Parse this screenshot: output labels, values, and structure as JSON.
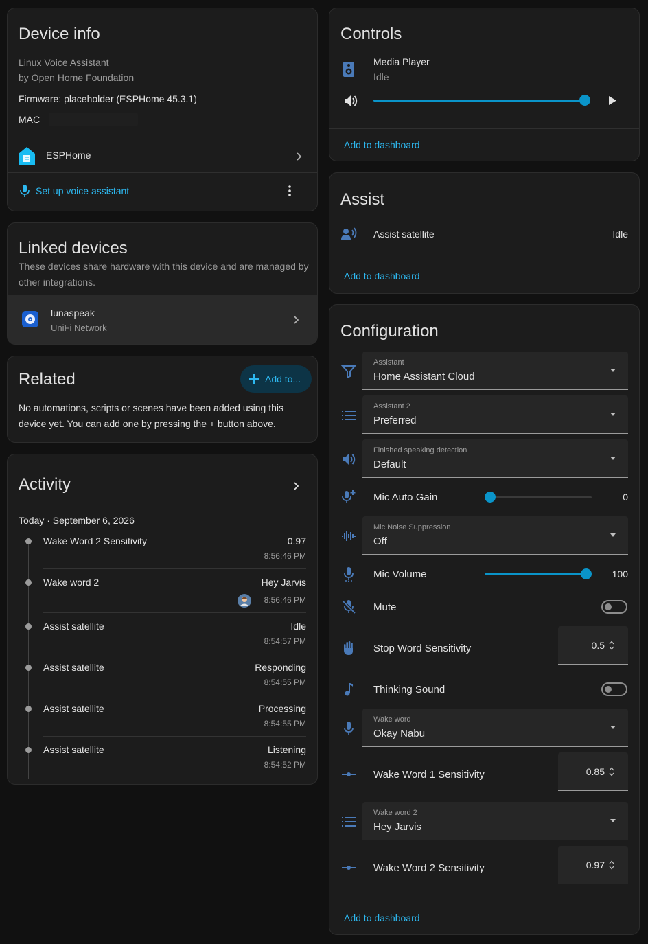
{
  "device_info": {
    "title": "Device info",
    "model": "Linux Voice Assistant",
    "manufacturer": "by Open Home Foundation",
    "firmware": "Firmware: placeholder (ESPHome 45.3.1)",
    "mac_label": "MAC",
    "integration": "ESPHome",
    "voice_link": "Set up voice assistant"
  },
  "linked": {
    "title": "Linked devices",
    "description": "These devices share hardware with this device and are managed by other integrations.",
    "device_name": "lunaspeak",
    "device_integration": "UniFi Network"
  },
  "related": {
    "title": "Related",
    "add_button": "Add to...",
    "empty_text": "No automations, scripts or scenes have been added using this device yet. You can add one by pressing the + button above."
  },
  "activity": {
    "title": "Activity",
    "date": "Today · September 6, 2026",
    "items": [
      {
        "name": "Wake Word 2 Sensitivity",
        "value": "0.97",
        "time": "8:56:46 PM"
      },
      {
        "name": "Wake word 2",
        "value": "Hey Jarvis",
        "time": "8:56:46 PM"
      },
      {
        "name": "Assist satellite",
        "value": "Idle",
        "time": "8:54:57 PM"
      },
      {
        "name": "Assist satellite",
        "value": "Responding",
        "time": "8:54:55 PM"
      },
      {
        "name": "Assist satellite",
        "value": "Processing",
        "time": "8:54:55 PM"
      },
      {
        "name": "Assist satellite",
        "value": "Listening",
        "time": "8:54:52 PM"
      }
    ]
  },
  "controls": {
    "title": "Controls",
    "media_name": "Media Player",
    "media_state": "Idle",
    "volume_fraction": 1.0,
    "add_link": "Add to dashboard"
  },
  "assist": {
    "title": "Assist",
    "entity": "Assist satellite",
    "state": "Idle",
    "add_link": "Add to dashboard"
  },
  "configuration": {
    "title": "Configuration",
    "assistant": {
      "label": "Assistant",
      "value": "Home Assistant Cloud"
    },
    "assistant2": {
      "label": "Assistant 2",
      "value": "Preferred"
    },
    "finished": {
      "label": "Finished speaking detection",
      "value": "Default"
    },
    "mic_gain": {
      "label": "Mic Auto Gain",
      "value": "0",
      "fraction": 0
    },
    "noise": {
      "label": "Mic Noise Suppression",
      "value": "Off"
    },
    "mic_volume": {
      "label": "Mic Volume",
      "value": "100",
      "fraction": 1.0
    },
    "mute": {
      "label": "Mute"
    },
    "stop_word": {
      "label": "Stop Word Sensitivity",
      "value": "0.5"
    },
    "thinking": {
      "label": "Thinking Sound"
    },
    "wake_word": {
      "label": "Wake word",
      "value": "Okay Nabu"
    },
    "ww1_sens": {
      "label": "Wake Word 1 Sensitivity",
      "value": "0.85"
    },
    "wake_word2": {
      "label": "Wake word 2",
      "value": "Hey Jarvis"
    },
    "ww2_sens": {
      "label": "Wake Word 2 Sensitivity",
      "value": "0.97"
    },
    "add_link": "Add to dashboard"
  },
  "colors": {
    "accent": "#2db8f0",
    "slider": "#0a94c9",
    "icon": "#4a7ab8",
    "card": "#1c1c1c"
  }
}
